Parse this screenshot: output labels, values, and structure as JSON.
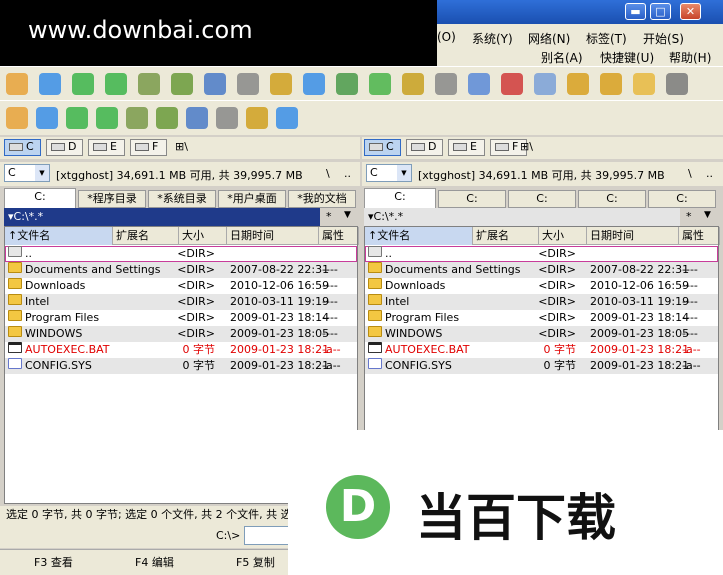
{
  "watermark": "www.downbai.com",
  "window_controls": {
    "minimize": "▬",
    "maximize": "□",
    "close": "✕"
  },
  "menus": {
    "row1": [
      "(O)",
      "系统(Y)",
      "网络(N)",
      "标签(T)",
      "开始(S)"
    ],
    "row2": [
      "别名(A)",
      "快捷键(U)",
      "帮助(H)"
    ]
  },
  "toolbar1_icons": [
    "gear-icon",
    "refresh-icon",
    "back-icon",
    "forward-icon",
    "tree-icon",
    "list-icon",
    "thumbnail-icon",
    "network-icon",
    "find-icon",
    "zoom-in-icon",
    "zoom-out-icon",
    "copy-icon",
    "move-icon",
    "tools-icon",
    "edit-icon",
    "check-icon",
    "chat-icon",
    "ftp-icon",
    "ftp-new-icon",
    "folder-open-icon",
    "pointer-icon"
  ],
  "toolbar2_icons": [
    "settings-icon",
    "disk-icon",
    "pie-icon",
    "ruler-icon",
    "print-icon",
    "grid-icon",
    "group-icon",
    "folder-icon",
    "network-drive-icon",
    "clip-icon"
  ],
  "drives": [
    "C",
    "D",
    "E",
    "F"
  ],
  "drive_separator": "\\",
  "left": {
    "combo": "C",
    "free_text": "[xtgghost]  34,691.1 MB 可用, 共 39,995.7 MB",
    "path_root": "\\",
    "path_up": "..",
    "tabs": [
      "C:",
      "*程序目录",
      "*系统目录",
      "*用户桌面",
      "*我的文档"
    ],
    "path": "C:\\*.*",
    "filter": "*",
    "columns": [
      "文件名",
      "扩展名",
      "大小",
      "日期时间",
      "属性"
    ],
    "rows": [
      {
        "icon": "up",
        "name": "..",
        "ext": "",
        "size": "<DIR>",
        "date": "",
        "attr": ""
      },
      {
        "icon": "folder",
        "name": "Documents and Settings",
        "ext": "",
        "size": "<DIR>",
        "date": "2007-08-22 22:31",
        "attr": "----"
      },
      {
        "icon": "folder",
        "name": "Downloads",
        "ext": "",
        "size": "<DIR>",
        "date": "2010-12-06 16:59",
        "attr": "----"
      },
      {
        "icon": "folder",
        "name": "Intel",
        "ext": "",
        "size": "<DIR>",
        "date": "2010-03-11 19:19",
        "attr": "----"
      },
      {
        "icon": "folder",
        "name": "Program Files",
        "ext": "",
        "size": "<DIR>",
        "date": "2009-01-23 18:14",
        "attr": "----"
      },
      {
        "icon": "folder",
        "name": "WINDOWS",
        "ext": "",
        "size": "<DIR>",
        "date": "2009-01-23 18:05",
        "attr": "----"
      },
      {
        "icon": "bat",
        "name": "AUTOEXEC.BAT",
        "ext": "",
        "size": "0 字节",
        "date": "2009-01-23 18:21",
        "attr": "-a--",
        "red": true
      },
      {
        "icon": "sys",
        "name": "CONFIG.SYS",
        "ext": "",
        "size": "0 字节",
        "date": "2009-01-23 18:21",
        "attr": "-a--"
      }
    ]
  },
  "right": {
    "combo": "C",
    "free_text": "[xtgghost]  34,691.1 MB 可用, 共 39,995.7 MB",
    "path_root": "\\",
    "path_up": "..",
    "tabs": [
      "C:",
      "C:",
      "C:",
      "C:",
      "C:"
    ],
    "path": "C:\\*.*",
    "filter": "*",
    "columns": [
      "文件名",
      "扩展名",
      "大小",
      "日期时间",
      "属性"
    ],
    "rows": [
      {
        "icon": "up",
        "name": "..",
        "ext": "",
        "size": "<DIR>",
        "date": "",
        "attr": ""
      },
      {
        "icon": "folder",
        "name": "Documents and Settings",
        "ext": "",
        "size": "<DIR>",
        "date": "2007-08-22 22:31",
        "attr": "----"
      },
      {
        "icon": "folder",
        "name": "Downloads",
        "ext": "",
        "size": "<DIR>",
        "date": "2010-12-06 16:59",
        "attr": "----"
      },
      {
        "icon": "folder",
        "name": "Intel",
        "ext": "",
        "size": "<DIR>",
        "date": "2010-03-11 19:19",
        "attr": "----"
      },
      {
        "icon": "folder",
        "name": "Program Files",
        "ext": "",
        "size": "<DIR>",
        "date": "2009-01-23 18:14",
        "attr": "----"
      },
      {
        "icon": "folder",
        "name": "WINDOWS",
        "ext": "",
        "size": "<DIR>",
        "date": "2009-01-23 18:05",
        "attr": "----"
      },
      {
        "icon": "bat",
        "name": "AUTOEXEC.BAT",
        "ext": "",
        "size": "0 字节",
        "date": "2009-01-23 18:21",
        "attr": "-a--",
        "red": true
      },
      {
        "icon": "sys",
        "name": "CONFIG.SYS",
        "ext": "",
        "size": "0 字节",
        "date": "2009-01-23 18:21",
        "attr": "-a--"
      }
    ]
  },
  "status": "选定 0 字节, 共 0 字节; 选定 0 个文件, 共 2 个文件, 共 选",
  "cmd_prompt": "C:\\>",
  "fkeys": [
    "F3 查看",
    "F4 编辑",
    "F5 复制"
  ],
  "logo": {
    "letter": "D",
    "text": "当百下载"
  },
  "colors": {
    "titlebar": "#1a4fb0",
    "path_active": "#1f3a8a",
    "red_file": "#e00000",
    "logo_green": "#5cb85c"
  }
}
